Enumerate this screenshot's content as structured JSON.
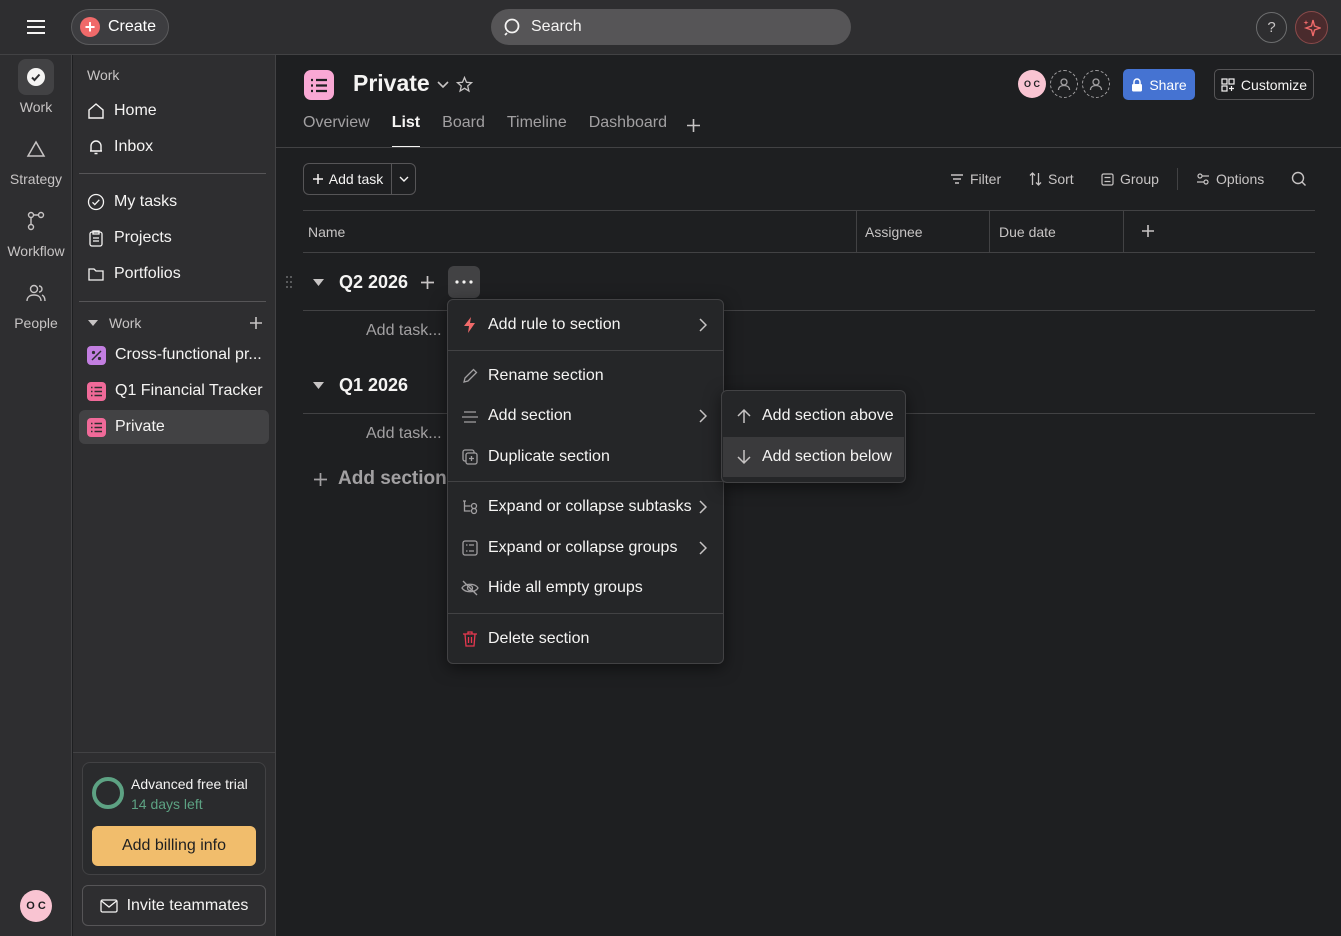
{
  "topbar": {
    "create_label": "Create",
    "search_label": "Search",
    "help_label": "?"
  },
  "rail": {
    "items": [
      {
        "label": "Work",
        "icon": "check-circle-icon"
      },
      {
        "label": "Strategy",
        "icon": "triangle-icon"
      },
      {
        "label": "Workflow",
        "icon": "workflow-icon"
      },
      {
        "label": "People",
        "icon": "people-icon"
      }
    ],
    "avatar_initials": "O C"
  },
  "sidebar": {
    "heading": "Work",
    "nav": [
      {
        "label": "Home",
        "icon": "home-icon"
      },
      {
        "label": "Inbox",
        "icon": "bell-icon"
      }
    ],
    "nav2": [
      {
        "label": "My tasks",
        "icon": "check-circle-icon"
      },
      {
        "label": "Projects",
        "icon": "clipboard-icon"
      },
      {
        "label": "Portfolios",
        "icon": "folder-icon"
      }
    ],
    "projects_heading": "Work",
    "projects": [
      {
        "label": "Cross-functional pr...",
        "color": "#c27ee0",
        "icon": "percent-icon"
      },
      {
        "label": "Q1 Financial Tracker",
        "color": "#f06a99",
        "icon": "list-icon"
      },
      {
        "label": "Private",
        "color": "#f06a99",
        "icon": "list-icon",
        "active": true
      }
    ],
    "trial": {
      "title": "Advanced free trial",
      "days_left": "14 days left",
      "billing_label": "Add billing info"
    },
    "invite_label": "Invite teammates"
  },
  "project": {
    "title": "Private",
    "tabs": [
      "Overview",
      "List",
      "Board",
      "Timeline",
      "Dashboard"
    ],
    "active_tab": "List",
    "share_label": "Share",
    "customize_label": "Customize",
    "avatar_initials": "O C"
  },
  "toolbar": {
    "add_task_label": "Add task",
    "filter_label": "Filter",
    "sort_label": "Sort",
    "group_label": "Group",
    "options_label": "Options"
  },
  "table": {
    "columns": [
      "Name",
      "Assignee",
      "Due date"
    ],
    "sections": [
      {
        "title": "Q2 2026",
        "placeholder": "Add task..."
      },
      {
        "title": "Q1 2026",
        "placeholder": "Add task..."
      }
    ],
    "add_section_label": "Add section"
  },
  "context_menu": {
    "items": [
      {
        "label": "Add rule to section",
        "icon": "lightning-icon",
        "has_submenu": true
      },
      {
        "label": "Rename section",
        "icon": "pencil-icon",
        "has_submenu": false
      },
      {
        "label": "Add section",
        "icon": "add-section-icon",
        "has_submenu": true
      },
      {
        "label": "Duplicate section",
        "icon": "duplicate-icon",
        "has_submenu": false
      },
      {
        "label": "Expand or collapse subtasks",
        "icon": "subtasks-icon",
        "has_submenu": true
      },
      {
        "label": "Expand or collapse groups",
        "icon": "groups-icon",
        "has_submenu": true
      },
      {
        "label": "Hide all empty groups",
        "icon": "eye-off-icon",
        "has_submenu": false
      },
      {
        "label": "Delete section",
        "icon": "trash-icon",
        "has_submenu": false
      }
    ]
  },
  "submenu": {
    "items": [
      {
        "label": "Add section above",
        "icon": "arrow-up-icon"
      },
      {
        "label": "Add section below",
        "icon": "arrow-down-icon",
        "hovered": true
      }
    ]
  },
  "colors": {
    "accent_blue": "#4573d2",
    "billing_orange": "#f1bd6c",
    "trial_green": "#5da283",
    "create_red": "#f06a6a",
    "project_pink": "#f9a8d4",
    "delete_red": "#e8384f"
  }
}
